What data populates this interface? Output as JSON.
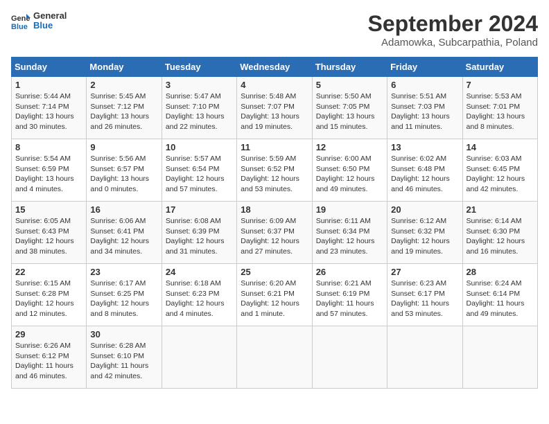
{
  "header": {
    "logo_line1": "General",
    "logo_line2": "Blue",
    "title": "September 2024",
    "subtitle": "Adamowka, Subcarpathia, Poland"
  },
  "days_of_week": [
    "Sunday",
    "Monday",
    "Tuesday",
    "Wednesday",
    "Thursday",
    "Friday",
    "Saturday"
  ],
  "weeks": [
    [
      {
        "day": "1",
        "info": "Sunrise: 5:44 AM\nSunset: 7:14 PM\nDaylight: 13 hours\nand 30 minutes."
      },
      {
        "day": "2",
        "info": "Sunrise: 5:45 AM\nSunset: 7:12 PM\nDaylight: 13 hours\nand 26 minutes."
      },
      {
        "day": "3",
        "info": "Sunrise: 5:47 AM\nSunset: 7:10 PM\nDaylight: 13 hours\nand 22 minutes."
      },
      {
        "day": "4",
        "info": "Sunrise: 5:48 AM\nSunset: 7:07 PM\nDaylight: 13 hours\nand 19 minutes."
      },
      {
        "day": "5",
        "info": "Sunrise: 5:50 AM\nSunset: 7:05 PM\nDaylight: 13 hours\nand 15 minutes."
      },
      {
        "day": "6",
        "info": "Sunrise: 5:51 AM\nSunset: 7:03 PM\nDaylight: 13 hours\nand 11 minutes."
      },
      {
        "day": "7",
        "info": "Sunrise: 5:53 AM\nSunset: 7:01 PM\nDaylight: 13 hours\nand 8 minutes."
      }
    ],
    [
      {
        "day": "8",
        "info": "Sunrise: 5:54 AM\nSunset: 6:59 PM\nDaylight: 13 hours\nand 4 minutes."
      },
      {
        "day": "9",
        "info": "Sunrise: 5:56 AM\nSunset: 6:57 PM\nDaylight: 13 hours\nand 0 minutes."
      },
      {
        "day": "10",
        "info": "Sunrise: 5:57 AM\nSunset: 6:54 PM\nDaylight: 12 hours\nand 57 minutes."
      },
      {
        "day": "11",
        "info": "Sunrise: 5:59 AM\nSunset: 6:52 PM\nDaylight: 12 hours\nand 53 minutes."
      },
      {
        "day": "12",
        "info": "Sunrise: 6:00 AM\nSunset: 6:50 PM\nDaylight: 12 hours\nand 49 minutes."
      },
      {
        "day": "13",
        "info": "Sunrise: 6:02 AM\nSunset: 6:48 PM\nDaylight: 12 hours\nand 46 minutes."
      },
      {
        "day": "14",
        "info": "Sunrise: 6:03 AM\nSunset: 6:45 PM\nDaylight: 12 hours\nand 42 minutes."
      }
    ],
    [
      {
        "day": "15",
        "info": "Sunrise: 6:05 AM\nSunset: 6:43 PM\nDaylight: 12 hours\nand 38 minutes."
      },
      {
        "day": "16",
        "info": "Sunrise: 6:06 AM\nSunset: 6:41 PM\nDaylight: 12 hours\nand 34 minutes."
      },
      {
        "day": "17",
        "info": "Sunrise: 6:08 AM\nSunset: 6:39 PM\nDaylight: 12 hours\nand 31 minutes."
      },
      {
        "day": "18",
        "info": "Sunrise: 6:09 AM\nSunset: 6:37 PM\nDaylight: 12 hours\nand 27 minutes."
      },
      {
        "day": "19",
        "info": "Sunrise: 6:11 AM\nSunset: 6:34 PM\nDaylight: 12 hours\nand 23 minutes."
      },
      {
        "day": "20",
        "info": "Sunrise: 6:12 AM\nSunset: 6:32 PM\nDaylight: 12 hours\nand 19 minutes."
      },
      {
        "day": "21",
        "info": "Sunrise: 6:14 AM\nSunset: 6:30 PM\nDaylight: 12 hours\nand 16 minutes."
      }
    ],
    [
      {
        "day": "22",
        "info": "Sunrise: 6:15 AM\nSunset: 6:28 PM\nDaylight: 12 hours\nand 12 minutes."
      },
      {
        "day": "23",
        "info": "Sunrise: 6:17 AM\nSunset: 6:25 PM\nDaylight: 12 hours\nand 8 minutes."
      },
      {
        "day": "24",
        "info": "Sunrise: 6:18 AM\nSunset: 6:23 PM\nDaylight: 12 hours\nand 4 minutes."
      },
      {
        "day": "25",
        "info": "Sunrise: 6:20 AM\nSunset: 6:21 PM\nDaylight: 12 hours\nand 1 minute."
      },
      {
        "day": "26",
        "info": "Sunrise: 6:21 AM\nSunset: 6:19 PM\nDaylight: 11 hours\nand 57 minutes."
      },
      {
        "day": "27",
        "info": "Sunrise: 6:23 AM\nSunset: 6:17 PM\nDaylight: 11 hours\nand 53 minutes."
      },
      {
        "day": "28",
        "info": "Sunrise: 6:24 AM\nSunset: 6:14 PM\nDaylight: 11 hours\nand 49 minutes."
      }
    ],
    [
      {
        "day": "29",
        "info": "Sunrise: 6:26 AM\nSunset: 6:12 PM\nDaylight: 11 hours\nand 46 minutes."
      },
      {
        "day": "30",
        "info": "Sunrise: 6:28 AM\nSunset: 6:10 PM\nDaylight: 11 hours\nand 42 minutes."
      },
      {
        "day": "",
        "info": ""
      },
      {
        "day": "",
        "info": ""
      },
      {
        "day": "",
        "info": ""
      },
      {
        "day": "",
        "info": ""
      },
      {
        "day": "",
        "info": ""
      }
    ]
  ]
}
